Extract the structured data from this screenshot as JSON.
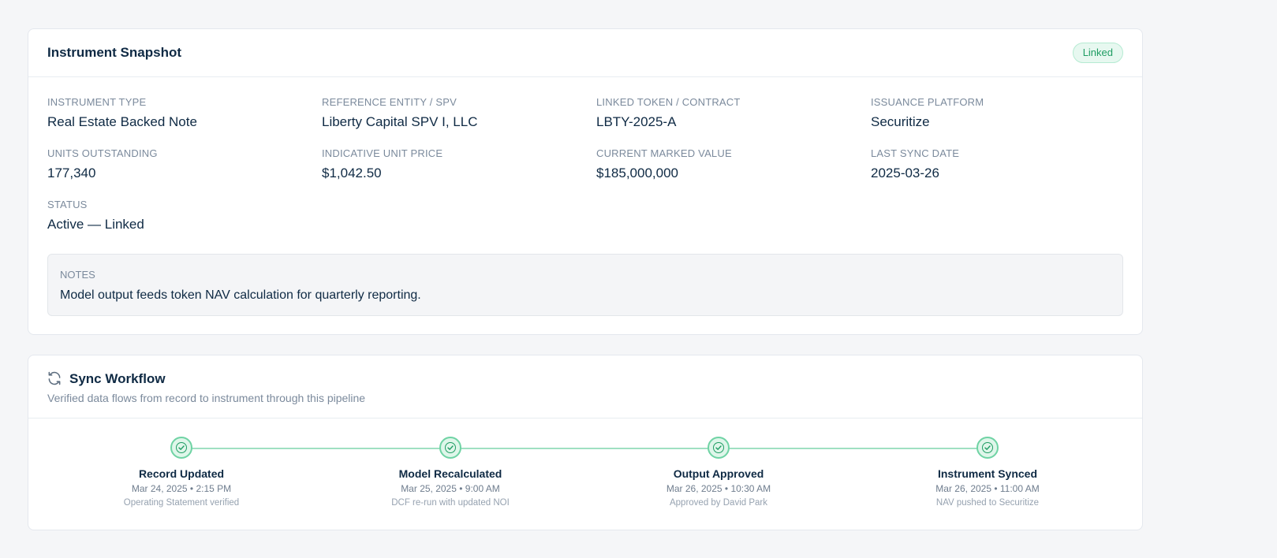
{
  "snapshot": {
    "title": "Instrument Snapshot",
    "badge": "Linked",
    "fields": [
      {
        "label": "Instrument Type",
        "value": "Real Estate Backed Note"
      },
      {
        "label": "Reference Entity / SPV",
        "value": "Liberty Capital SPV I, LLC"
      },
      {
        "label": "Linked Token / Contract",
        "value": "LBTY-2025-A"
      },
      {
        "label": "Issuance Platform",
        "value": "Securitize"
      },
      {
        "label": "Units Outstanding",
        "value": "177,340"
      },
      {
        "label": "Indicative Unit Price",
        "value": "$1,042.50"
      },
      {
        "label": "Current Marked Value",
        "value": "$185,000,000"
      },
      {
        "label": "Last Sync Date",
        "value": "2025-03-26"
      },
      {
        "label": "Status",
        "value": "Active — Linked"
      }
    ],
    "notes": {
      "label": "Notes",
      "text": "Model output feeds token NAV calculation for quarterly reporting."
    }
  },
  "workflow": {
    "title": "Sync Workflow",
    "subtitle": "Verified data flows from record to instrument through this pipeline",
    "icon": "refresh-icon",
    "steps": [
      {
        "title": "Record Updated",
        "time": "Mar 24, 2025 • 2:15 PM",
        "note": "Operating Statement verified"
      },
      {
        "title": "Model Recalculated",
        "time": "Mar 25, 2025 • 9:00 AM",
        "note": "DCF re-run with updated NOI"
      },
      {
        "title": "Output Approved",
        "time": "Mar 26, 2025 • 10:30 AM",
        "note": "Approved by David Park"
      },
      {
        "title": "Instrument Synced",
        "time": "Mar 26, 2025 • 11:00 AM",
        "note": "NAV pushed to Securitize"
      }
    ]
  },
  "colors": {
    "accent_green": "#1f9d63",
    "text_primary": "#0f2a44",
    "text_muted": "#7b8a9c"
  }
}
